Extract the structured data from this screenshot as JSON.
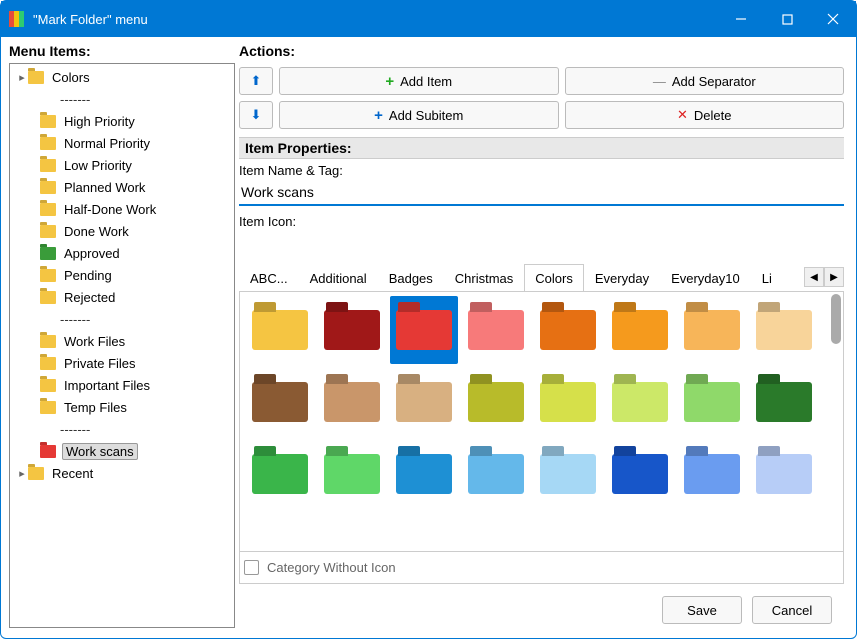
{
  "window": {
    "title": "\"Mark Folder\" menu"
  },
  "labels": {
    "menu_items": "Menu Items:",
    "actions": "Actions:",
    "item_properties": "Item Properties:",
    "item_name_tag": "Item Name & Tag:",
    "item_icon": "Item Icon:",
    "category_without_icon": "Category Without Icon"
  },
  "buttons": {
    "add_item": "Add Item",
    "add_subitem": "Add Subitem",
    "add_separator": "Add Separator",
    "delete": "Delete",
    "save": "Save",
    "cancel": "Cancel"
  },
  "tree": [
    {
      "type": "group",
      "label": "Colors",
      "color": "#f4c542",
      "expandable": true
    },
    {
      "type": "sep"
    },
    {
      "type": "item",
      "label": "High Priority",
      "color": "#f4c542",
      "badge": "#d33"
    },
    {
      "type": "item",
      "label": "Normal Priority",
      "color": "#f4c542",
      "badge": "#4a4"
    },
    {
      "type": "item",
      "label": "Low Priority",
      "color": "#f4c542",
      "badge": "#39d"
    },
    {
      "type": "item",
      "label": "Planned Work",
      "color": "#f4c542"
    },
    {
      "type": "item",
      "label": "Half-Done Work",
      "color": "#f4c542"
    },
    {
      "type": "item",
      "label": "Done Work",
      "color": "#f4c542",
      "badge": "#39d"
    },
    {
      "type": "item",
      "label": "Approved",
      "color": "#3a9c3a"
    },
    {
      "type": "item",
      "label": "Pending",
      "color": "#f4c542"
    },
    {
      "type": "item",
      "label": "Rejected",
      "color": "#f4c542",
      "badge": "#d33"
    },
    {
      "type": "sep"
    },
    {
      "type": "item",
      "label": "Work Files",
      "color": "#f4c542"
    },
    {
      "type": "item",
      "label": "Private Files",
      "color": "#f4c542"
    },
    {
      "type": "item",
      "label": "Important Files",
      "color": "#f4c542"
    },
    {
      "type": "item",
      "label": "Temp Files",
      "color": "#f4c542"
    },
    {
      "type": "sep"
    },
    {
      "type": "item",
      "label": "Work scans",
      "color": "#e53935",
      "selected": true
    },
    {
      "type": "group",
      "label": "Recent",
      "color": "#f4c542",
      "expandable": true
    }
  ],
  "form": {
    "item_name_value": "Work scans"
  },
  "tabs": {
    "items": [
      "ABC...",
      "Additional",
      "Badges",
      "Christmas",
      "Colors",
      "Everyday",
      "Everyday10",
      "Li"
    ],
    "active": 4
  },
  "icon_grid": {
    "selected": 2,
    "colors": [
      "#f5c542",
      "#a01818",
      "#e53935",
      "#f77a7a",
      "#e67013",
      "#f59a1d",
      "#f7b559",
      "#f8d49a",
      "#8a5a33",
      "#c9966a",
      "#d8b081",
      "#b8bb2a",
      "#d6e04a",
      "#cce868",
      "#8fd96a",
      "#2a7a2a",
      "#3ab54a",
      "#5fd768",
      "#1e90d4",
      "#64b8ea",
      "#a6d8f5",
      "#1756c9",
      "#6a9cf0",
      "#b7cdf7"
    ]
  }
}
